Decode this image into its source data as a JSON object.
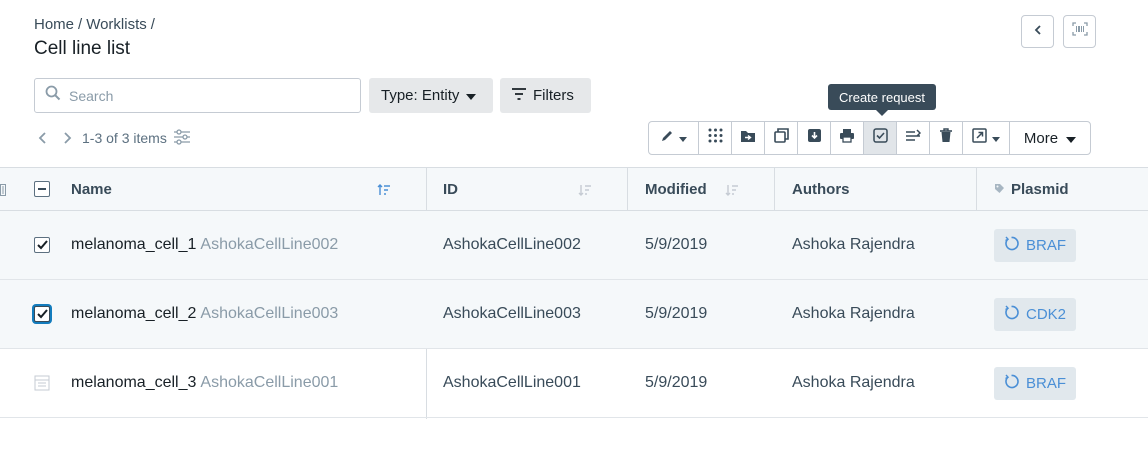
{
  "breadcrumb": {
    "home": "Home",
    "sep1": "/",
    "worklists": "Worklists",
    "sep2": "/"
  },
  "page_title": "Cell line list",
  "search": {
    "placeholder": "Search",
    "value": ""
  },
  "type_filter": {
    "label": "Type: Entity"
  },
  "filters_button": {
    "label": "Filters"
  },
  "tooltip": {
    "text": "Create request"
  },
  "pager": {
    "range": "1-3 of 3 items"
  },
  "toolbar": {
    "more_label": "More"
  },
  "table": {
    "headers": {
      "name": "Name",
      "id": "ID",
      "modified": "Modified",
      "authors": "Authors",
      "plasmid": "Plasmid"
    },
    "rows": [
      {
        "name": "melanoma_cell_1",
        "name_sub": "AshokaCellLine002",
        "id": "AshokaCellLine002",
        "modified": "5/9/2019",
        "author": "Ashoka Rajendra",
        "plasmid": "BRAF",
        "checked": true
      },
      {
        "name": "melanoma_cell_2",
        "name_sub": "AshokaCellLine003",
        "id": "AshokaCellLine003",
        "modified": "5/9/2019",
        "author": "Ashoka Rajendra",
        "plasmid": "CDK2",
        "checked": true
      },
      {
        "name": "melanoma_cell_3",
        "name_sub": "AshokaCellLine001",
        "id": "AshokaCellLine001",
        "modified": "5/9/2019",
        "author": "Ashoka Rajendra",
        "plasmid": "BRAF",
        "checked": false
      }
    ]
  },
  "colors": {
    "accent": "#4a8fd6",
    "tooltip_bg": "#394b59",
    "header_bg": "#f5f8fa",
    "selected_bg": "#f5f8fa",
    "focus_ring": "#137cbd"
  }
}
